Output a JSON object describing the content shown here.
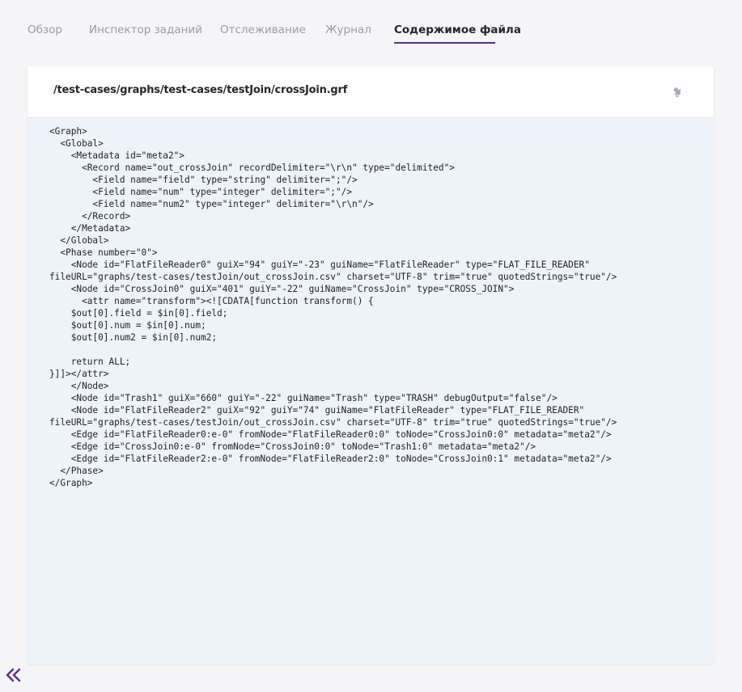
{
  "tabs": [
    {
      "label": "Обзор",
      "active": false
    },
    {
      "label": "Инспектор заданий",
      "active": false
    },
    {
      "label": "Отслеживание",
      "active": false
    },
    {
      "label": "Журнал",
      "active": false
    },
    {
      "label": "Содержимое файла",
      "active": true
    }
  ],
  "file": {
    "path": "/test-cases/graphs/test-cases/testJoin/crossJoin.grf",
    "content": "<Graph>\n  <Global>\n    <Metadata id=\"meta2\">\n      <Record name=\"out_crossJoin\" recordDelimiter=\"\\r\\n\" type=\"delimited\">\n        <Field name=\"field\" type=\"string\" delimiter=\";\"/>\n        <Field name=\"num\" type=\"integer\" delimiter=\";\"/>\n        <Field name=\"num2\" type=\"integer\" delimiter=\"\\r\\n\"/>\n      </Record>\n    </Metadata>\n  </Global>\n  <Phase number=\"0\">\n    <Node id=\"FlatFileReader0\" guiX=\"94\" guiY=\"-23\" guiName=\"FlatFileReader\" type=\"FLAT_FILE_READER\"\nfileURL=\"graphs/test-cases/testJoin/out_crossJoin.csv\" charset=\"UTF-8\" trim=\"true\" quotedStrings=\"true\"/>\n    <Node id=\"CrossJoin0\" guiX=\"401\" guiY=\"-22\" guiName=\"CrossJoin\" type=\"CROSS_JOIN\">\n      <attr name=\"transform\"><![CDATA[function transform() {\n    $out[0].field = $in[0].field;\n    $out[0].num = $in[0].num;\n    $out[0].num2 = $in[0].num2;\n\n    return ALL;\n}]]></attr>\n    </Node>\n    <Node id=\"Trash1\" guiX=\"660\" guiY=\"-22\" guiName=\"Trash\" type=\"TRASH\" debugOutput=\"false\"/>\n    <Node id=\"FlatFileReader2\" guiX=\"92\" guiY=\"74\" guiName=\"FlatFileReader\" type=\"FLAT_FILE_READER\"\nfileURL=\"graphs/test-cases/testJoin/out_crossJoin.csv\" charset=\"UTF-8\" trim=\"true\" quotedStrings=\"true\"/>\n    <Edge id=\"FlatFileReader0:e-0\" fromNode=\"FlatFileReader0:0\" toNode=\"CrossJoin0:0\" metadata=\"meta2\"/>\n    <Edge id=\"CrossJoin0:e-0\" fromNode=\"CrossJoin0:0\" toNode=\"Trash1:0\" metadata=\"meta2\"/>\n    <Edge id=\"FlatFileReader2:e-0\" fromNode=\"FlatFileReader2:0\" toNode=\"CrossJoin0:1\" metadata=\"meta2\"/>\n  </Phase>\n</Graph>"
  },
  "icons": {
    "download": "download-icon",
    "collapse": "double-chevron-left-icon"
  },
  "colors": {
    "accent": "#5c2d91",
    "tab_inactive": "#9a9ba3",
    "code_background": "#eef3fa"
  }
}
